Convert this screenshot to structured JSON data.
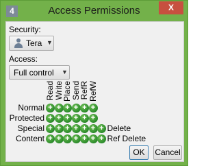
{
  "window": {
    "title": "Access Permissions",
    "app_icon_text": "4",
    "close_glyph": "X"
  },
  "security": {
    "label": "Security:",
    "selected": "Tera"
  },
  "access": {
    "label": "Access:",
    "selected": "Full control"
  },
  "permissions": {
    "columns": [
      "Read",
      "Write",
      "Place",
      "Send",
      "RefR",
      "RefW"
    ],
    "rows": [
      {
        "label": "Normal",
        "count": 6,
        "extra": ""
      },
      {
        "label": "Protected",
        "count": 6,
        "extra": ""
      },
      {
        "label": "Special",
        "count": 7,
        "extra": "Delete"
      },
      {
        "label": "Content",
        "count": 7,
        "extra": "Ref Delete"
      }
    ],
    "checkbox_glyph": "+"
  },
  "buttons": {
    "ok": "OK",
    "cancel": "Cancel"
  },
  "colors": {
    "frame": "#73b14a",
    "close": "#c7503f",
    "checkbox": "#2a8a2a"
  }
}
